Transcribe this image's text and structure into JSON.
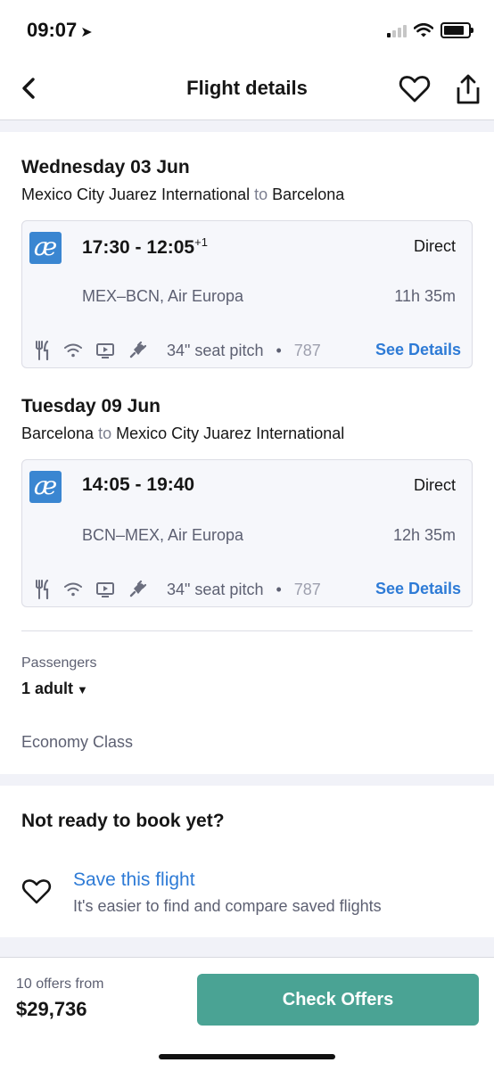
{
  "status": {
    "time": "09:07"
  },
  "nav": {
    "title": "Flight details"
  },
  "outbound": {
    "day": "Wednesday 03 Jun",
    "from": "Mexico City Juarez International",
    "to_word": "to",
    "to": "Barcelona",
    "airline_logo_text": "æ",
    "depart": "17:30",
    "arrive": "12:05",
    "day_offset": "+1",
    "stops": "Direct",
    "route": "MEX–BCN, Air Europa",
    "duration": "11h 35m",
    "seat_pitch": "34\" seat pitch",
    "separator": "•",
    "aircraft": "787",
    "details_label": "See Details"
  },
  "inbound": {
    "day": "Tuesday 09 Jun",
    "from": "Barcelona",
    "to_word": "to",
    "to": "Mexico City Juarez International",
    "airline_logo_text": "æ",
    "depart": "14:05",
    "arrive": "19:40",
    "stops": "Direct",
    "route": "BCN–MEX, Air Europa",
    "duration": "12h 35m",
    "seat_pitch": "34\" seat pitch",
    "separator": "•",
    "aircraft": "787",
    "details_label": "See Details"
  },
  "amenity_icons": [
    "meal-icon",
    "wifi-icon",
    "entertainment-icon",
    "power-icon"
  ],
  "passengers": {
    "label": "Passengers",
    "value": "1 adult",
    "cabin": "Economy Class"
  },
  "not_ready": {
    "title": "Not ready to book yet?",
    "save_title": "Save this flight",
    "save_subtitle": "It's easier to find and compare saved flights"
  },
  "footer": {
    "offers_count": "10 offers from",
    "price": "$29,736",
    "button_label": "Check Offers"
  },
  "colors": {
    "accent_blue": "#2e7bd6",
    "button_green": "#4aa394",
    "airline_logo": "#3a86d1"
  }
}
